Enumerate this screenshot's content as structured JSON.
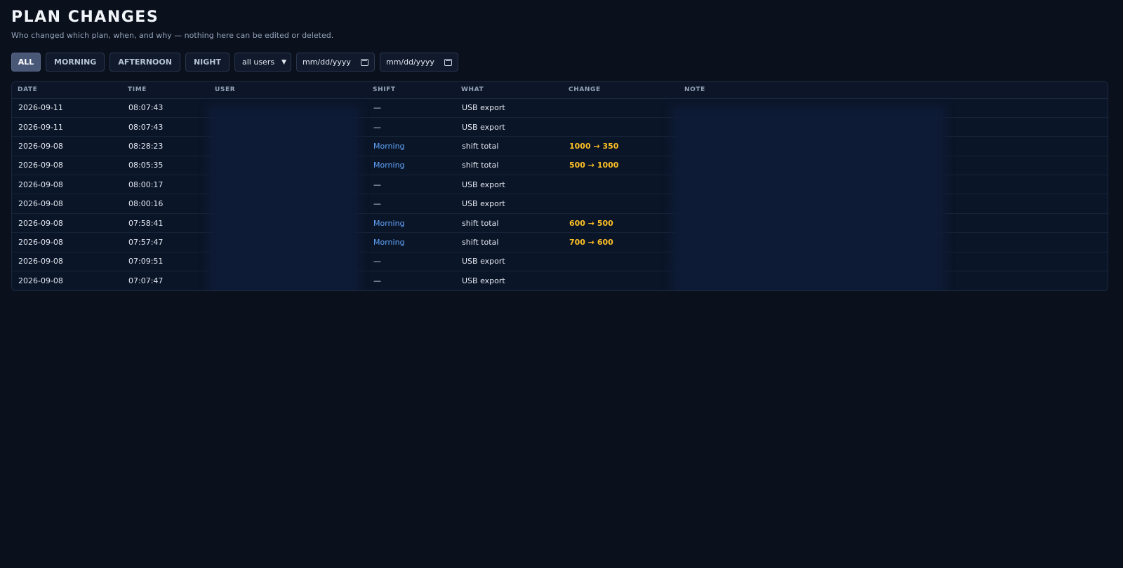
{
  "header": {
    "title": "PLAN CHANGES",
    "subtitle": "Who changed which plan, when, and why — nothing here can be edited or deleted."
  },
  "filters": {
    "shift_buttons": [
      {
        "label": "ALL",
        "active": true
      },
      {
        "label": "MORNING",
        "active": false
      },
      {
        "label": "AFTERNOON",
        "active": false
      },
      {
        "label": "NIGHT",
        "active": false
      }
    ],
    "user_select": {
      "value": "all users"
    },
    "date_from": {
      "placeholder": "mm/dd/yyyy"
    },
    "date_to": {
      "placeholder": "mm/dd/yyyy"
    }
  },
  "table": {
    "columns": [
      "DATE",
      "TIME",
      "USER",
      "SHIFT",
      "WHAT",
      "CHANGE",
      "NOTE"
    ],
    "rows": [
      {
        "date": "2026-09-11",
        "time": "08:07:43",
        "user": "",
        "shift": "—",
        "what": "USB export",
        "change": "",
        "note": ""
      },
      {
        "date": "2026-09-11",
        "time": "08:07:43",
        "user": "",
        "shift": "—",
        "what": "USB export",
        "change": "",
        "note": ""
      },
      {
        "date": "2026-09-08",
        "time": "08:28:23",
        "user": "",
        "shift": "Morning",
        "what": "shift total",
        "change": "1000 → 350",
        "note": ""
      },
      {
        "date": "2026-09-08",
        "time": "08:05:35",
        "user": "",
        "shift": "Morning",
        "what": "shift total",
        "change": "500 → 1000",
        "note": ""
      },
      {
        "date": "2026-09-08",
        "time": "08:00:17",
        "user": "",
        "shift": "—",
        "what": "USB export",
        "change": "",
        "note": ""
      },
      {
        "date": "2026-09-08",
        "time": "08:00:16",
        "user": "",
        "shift": "—",
        "what": "USB export",
        "change": "",
        "note": ""
      },
      {
        "date": "2026-09-08",
        "time": "07:58:41",
        "user": "",
        "shift": "Morning",
        "what": "shift total",
        "change": "600 → 500",
        "note": ""
      },
      {
        "date": "2026-09-08",
        "time": "07:57:47",
        "user": "",
        "shift": "Morning",
        "what": "shift total",
        "change": "700 → 600",
        "note": ""
      },
      {
        "date": "2026-09-08",
        "time": "07:09:51",
        "user": "",
        "shift": "—",
        "what": "USB export",
        "change": "",
        "note": ""
      },
      {
        "date": "2026-09-08",
        "time": "07:07:47",
        "user": "",
        "shift": "—",
        "what": "USB export",
        "change": "",
        "note": ""
      }
    ]
  },
  "colors": {
    "background": "#0a101c",
    "shift_accent": "#60a5fa",
    "change_accent": "#fbbf24",
    "active_filter": "#4a5878"
  },
  "icons": {
    "select_chevron": "chevron-down-icon",
    "date_picker": "calendar-icon"
  }
}
